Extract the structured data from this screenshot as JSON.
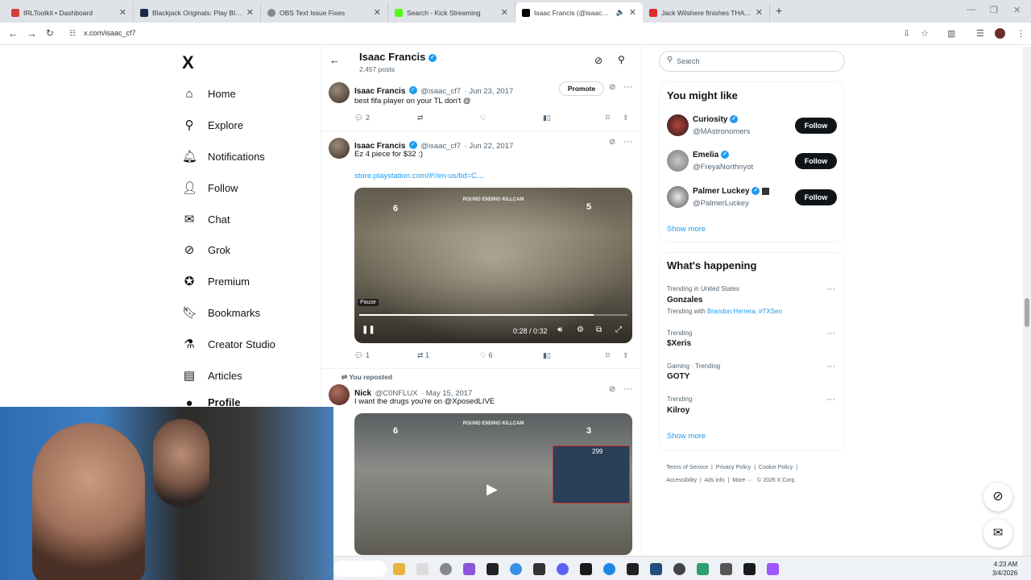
{
  "browser": {
    "tabs": [
      {
        "title": "IRLToolkit • Dashboard",
        "color": "#d43f3a"
      },
      {
        "title": "Blackjack Originals: Play Blackja",
        "color": "#1b2a4a"
      },
      {
        "title": "OBS Text Issue Fixes",
        "color": "#888888"
      },
      {
        "title": "Search - Kick Streaming",
        "color": "#53fc18"
      },
      {
        "title": "Isaac Francis (@isaac_cf7) /",
        "color": "#000000"
      },
      {
        "title": "Jack Wilshere finishes THAT Ars",
        "color": "#e02b2b"
      }
    ],
    "new_tab": "+",
    "url": "x.com/isaac_cf7"
  },
  "left_nav": {
    "logo": "X",
    "items": [
      {
        "label": "Home",
        "icon": "home-icon"
      },
      {
        "label": "Explore",
        "icon": "search-icon"
      },
      {
        "label": "Notifications",
        "icon": "bell-icon"
      },
      {
        "label": "Follow",
        "icon": "person-add-icon"
      },
      {
        "label": "Chat",
        "icon": "mail-icon"
      },
      {
        "label": "Grok",
        "icon": "grok-icon"
      },
      {
        "label": "Premium",
        "icon": "verified-icon"
      },
      {
        "label": "Bookmarks",
        "icon": "bookmark-icon"
      },
      {
        "label": "Creator Studio",
        "icon": "flask-icon"
      },
      {
        "label": "Articles",
        "icon": "article-icon"
      },
      {
        "label": "Profile",
        "icon": "person-icon"
      }
    ]
  },
  "profile_header": {
    "name": "Isaac Francis",
    "posts": "2,457 posts"
  },
  "tweets": [
    {
      "name": "Isaac Francis",
      "handle": "@isaac_cf7",
      "date": "· Jun 23, 2017",
      "text": "best fifa player on your TL don't @",
      "promote": "Promote",
      "replies": "2",
      "retweets": "",
      "likes": ""
    },
    {
      "name": "Isaac Francis",
      "handle": "@isaac_cf7",
      "date": "· Jun 22, 2017",
      "text": "Ez 4 piece for $32 :)",
      "link": "store.playstation.com/#!/en-us/tid=C…",
      "video": {
        "banner": "ROUND ENDING KILLCAM",
        "time": "0:28 / 0:32",
        "tooltip": "Pause",
        "progress": 0.875,
        "score_left": "6",
        "score_right": "5"
      },
      "replies": "1",
      "retweets": "1",
      "likes": "6"
    },
    {
      "repost_label": "You reposted",
      "name": "Nick",
      "handle": "@C0NFLUX",
      "date": "· May 15, 2017",
      "text": "I want the drugs you're on @XposedLIVE",
      "video": {
        "banner": "ROUND ENDING KILLCAM",
        "score_left": "6",
        "score_right": "3",
        "overlay_score": "299"
      }
    }
  ],
  "right": {
    "search_placeholder": "Search",
    "you_might_like": {
      "title": "You might like",
      "users": [
        {
          "name": "Curiosity",
          "handle": "@MAstronomers",
          "button": "Follow"
        },
        {
          "name": "Emelia",
          "handle": "@FreyaNorthnyot",
          "button": "Follow"
        },
        {
          "name": "Palmer Luckey",
          "handle": "@PalmerLuckey",
          "button": "Follow"
        }
      ],
      "show_more": "Show more"
    },
    "happening": {
      "title": "What's happening",
      "trends": [
        {
          "meta": "Trending in United States",
          "title": "Gonzales",
          "extra_prefix": "Trending with ",
          "extra_links": "Brandon Herrera, #TXSen"
        },
        {
          "meta": "Trending",
          "title": "$Xeris"
        },
        {
          "meta": "Gaming · Trending",
          "title": "GOTY"
        },
        {
          "meta": "Trending",
          "title": "Kilroy"
        }
      ],
      "show_more": "Show more"
    },
    "footer": {
      "links": [
        "Terms of Service",
        "Privacy Policy",
        "Cookie Policy",
        "Accessibility",
        "Ads info",
        "More ···"
      ],
      "copyright": "© 2026 X Corp."
    }
  },
  "taskbar": {
    "time": "4:23 AM",
    "date": "3/4/2026"
  },
  "colors": {
    "accent": "#1d9bf0",
    "text": "#0f1419",
    "muted": "#536471"
  }
}
